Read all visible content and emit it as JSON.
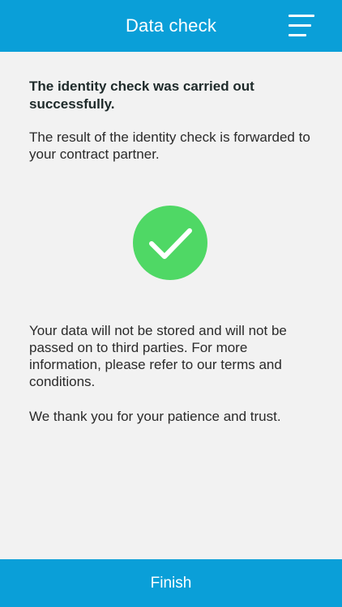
{
  "header": {
    "title": "Data check",
    "menu_icon": "hamburger-menu-icon"
  },
  "main": {
    "heading": "The identity check was carried out successfully.",
    "intro": "The result of the identity check is forwarded to your contract partner.",
    "status_icon": "success-check-icon",
    "privacy_notice": "Your data will not be stored and will not be passed on to third parties. For more information, please refer to our terms and conditions.",
    "thanks": "We thank you for your patience and trust."
  },
  "footer": {
    "finish_label": "Finish"
  },
  "colors": {
    "accent": "#0a9fd8",
    "success": "#4fd865",
    "background": "#f2f2f2"
  }
}
